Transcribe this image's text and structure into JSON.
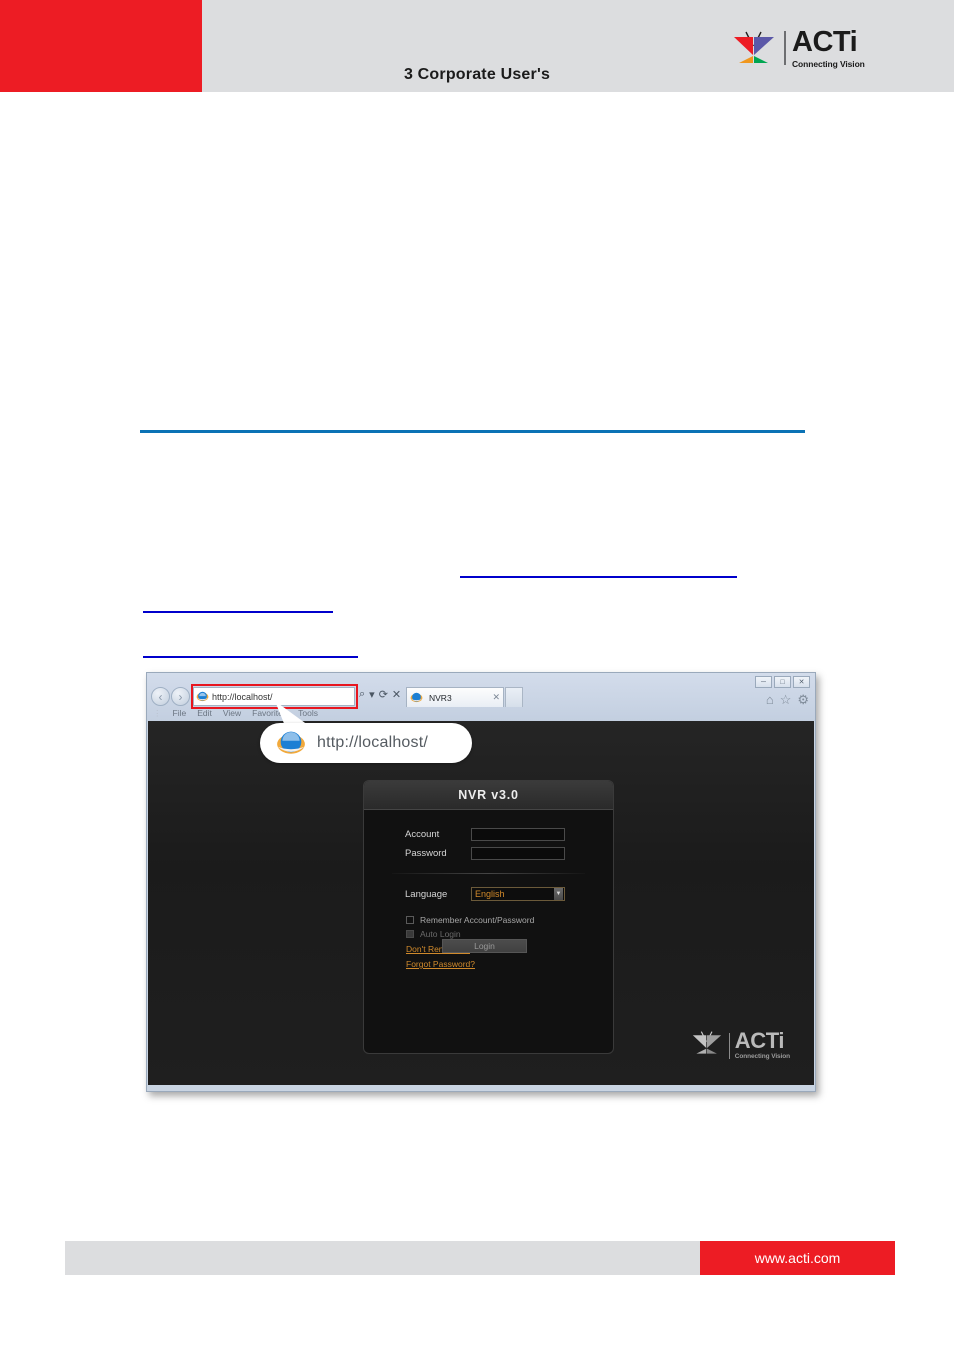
{
  "document": {
    "header": {
      "title": "3 Corporate User's",
      "brand": {
        "name": "ACTi",
        "tagline": "Connecting Vision",
        "colors": {
          "red": "#ed1c24",
          "purple": "#5b58a8",
          "orange": "#f0971e",
          "green": "#00a651",
          "header_band": "#dcdddf"
        }
      }
    },
    "body": {
      "rule_color": "#0b72b5",
      "link_underline_color": "#0000cc"
    },
    "footer": {
      "url": "www.acti.com",
      "bar_color": "#ed1c24",
      "gray_color": "#dcdddf"
    }
  },
  "browser": {
    "nav": {
      "back_icon": "back-arrow-icon",
      "forward_icon": "forward-arrow-icon"
    },
    "address_bar": {
      "value": "http://localhost/",
      "favicon": "internet-explorer-icon",
      "highlight_color": "#e8161f"
    },
    "address_tools": {
      "search": "⌕",
      "dropdown": "▾",
      "refresh": "⟳",
      "stop": "✕"
    },
    "tab": {
      "favicon": "internet-explorer-icon",
      "title": "NVR3",
      "close": "✕"
    },
    "menu": [
      "File",
      "Edit",
      "View",
      "Favorites",
      "Tools"
    ],
    "window_controls": {
      "minimize": "─",
      "maximize": "□",
      "close": "✕"
    },
    "chrome_icons": {
      "home": "⌂",
      "favorites": "☆",
      "tools": "⚙"
    },
    "callout": {
      "icon": "internet-explorer-icon",
      "url": "http://localhost/"
    }
  },
  "nvr_login": {
    "title": "NVR v3.0",
    "fields": [
      {
        "label": "Account",
        "value": ""
      },
      {
        "label": "Password",
        "value": ""
      }
    ],
    "language": {
      "label": "Language",
      "value": "English",
      "accent_color": "#d38a2a"
    },
    "checkboxes": [
      {
        "label": "Remember Account/Password",
        "checked": false,
        "disabled": false
      },
      {
        "label": "Auto Login",
        "checked": false,
        "disabled": true
      }
    ],
    "links": [
      "Don't Remember",
      "Forgot Password?"
    ],
    "login_button": "Login",
    "brand": {
      "name": "ACTi",
      "tagline": "Connecting Vision"
    }
  }
}
